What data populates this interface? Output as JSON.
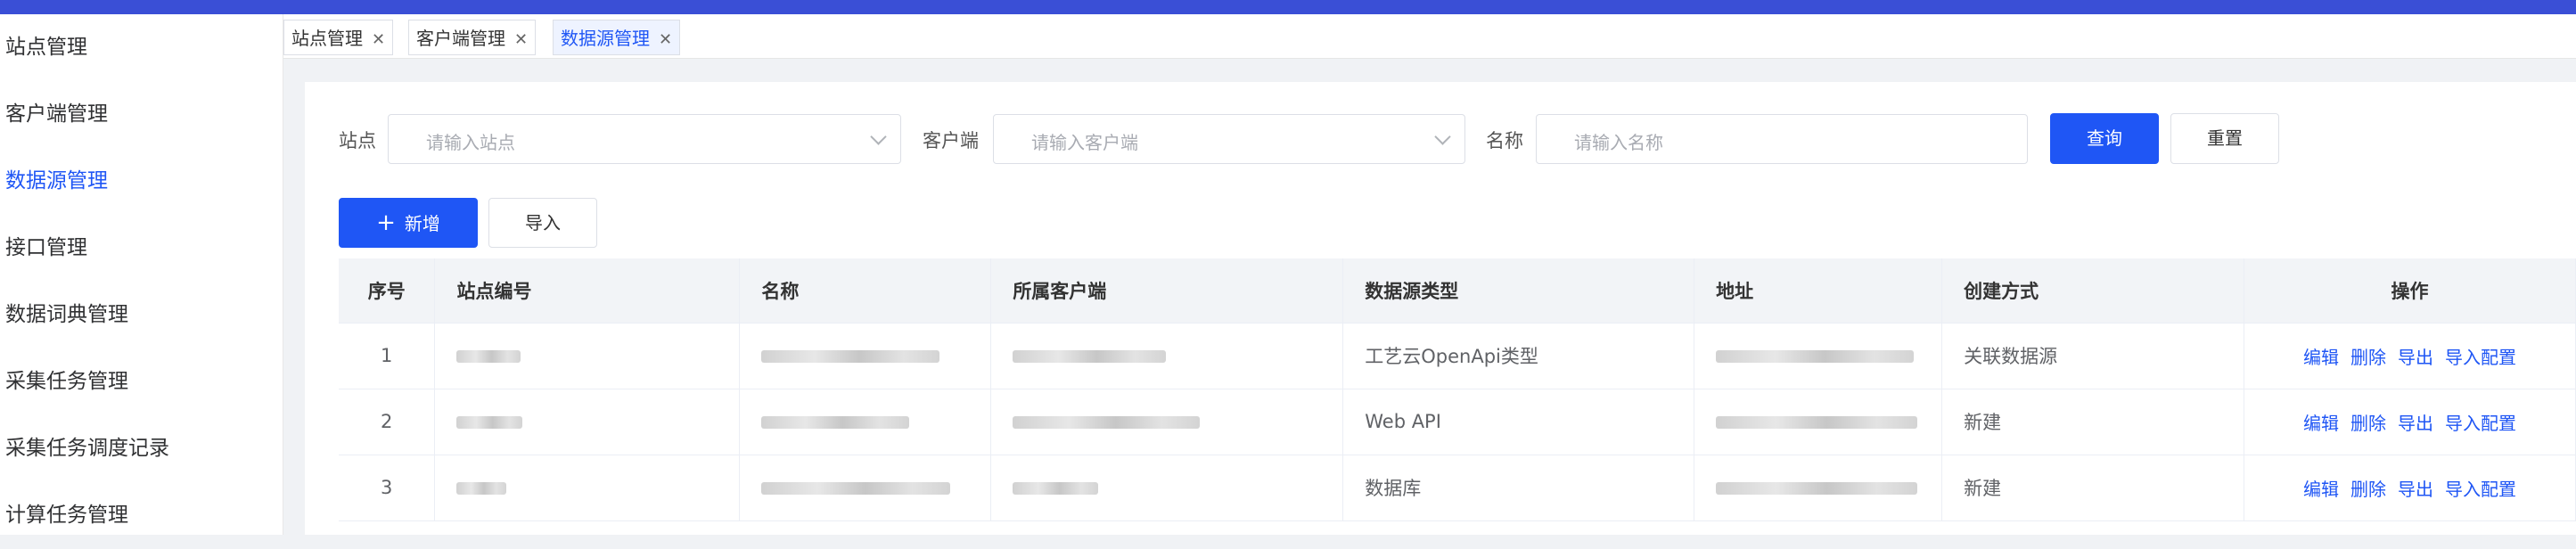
{
  "sidebar": {
    "items": [
      {
        "label": "站点管理"
      },
      {
        "label": "客户端管理"
      },
      {
        "label": "数据源管理"
      },
      {
        "label": "接口管理"
      },
      {
        "label": "数据词典管理"
      },
      {
        "label": "采集任务管理"
      },
      {
        "label": "采集任务调度记录"
      },
      {
        "label": "计算任务管理"
      }
    ],
    "active": "数据源管理"
  },
  "tabs": [
    {
      "label": "站点管理"
    },
    {
      "label": "客户端管理"
    },
    {
      "label": "数据源管理",
      "active": true
    }
  ],
  "filters": {
    "site": {
      "label": "站点",
      "placeholder": "请输入站点"
    },
    "client": {
      "label": "客户端",
      "placeholder": "请输入客户端"
    },
    "name": {
      "label": "名称",
      "placeholder": "请输入名称"
    }
  },
  "buttons": {
    "query": "查询",
    "reset": "重置",
    "add": "新增",
    "add_icon": "+",
    "import": "导入"
  },
  "table": {
    "columns": [
      "序号",
      "站点编号",
      "名称",
      "所属客户端",
      "数据源类型",
      "地址",
      "创建方式",
      "操作"
    ],
    "rows": [
      {
        "index": "1",
        "type": "工艺云OpenApi类型",
        "method": "关联数据源"
      },
      {
        "index": "2",
        "type": "Web API",
        "method": "新建"
      },
      {
        "index": "3",
        "type": "数据库",
        "method": "新建"
      }
    ],
    "actions": [
      "编辑",
      "删除",
      "导出",
      "导入配置"
    ]
  },
  "colors": {
    "accent": "#1f56f5",
    "topbar": "#3a4fd6"
  },
  "icons": {
    "close": "close-icon",
    "dropdown": "chevron-down-icon",
    "add": "plus-icon"
  }
}
